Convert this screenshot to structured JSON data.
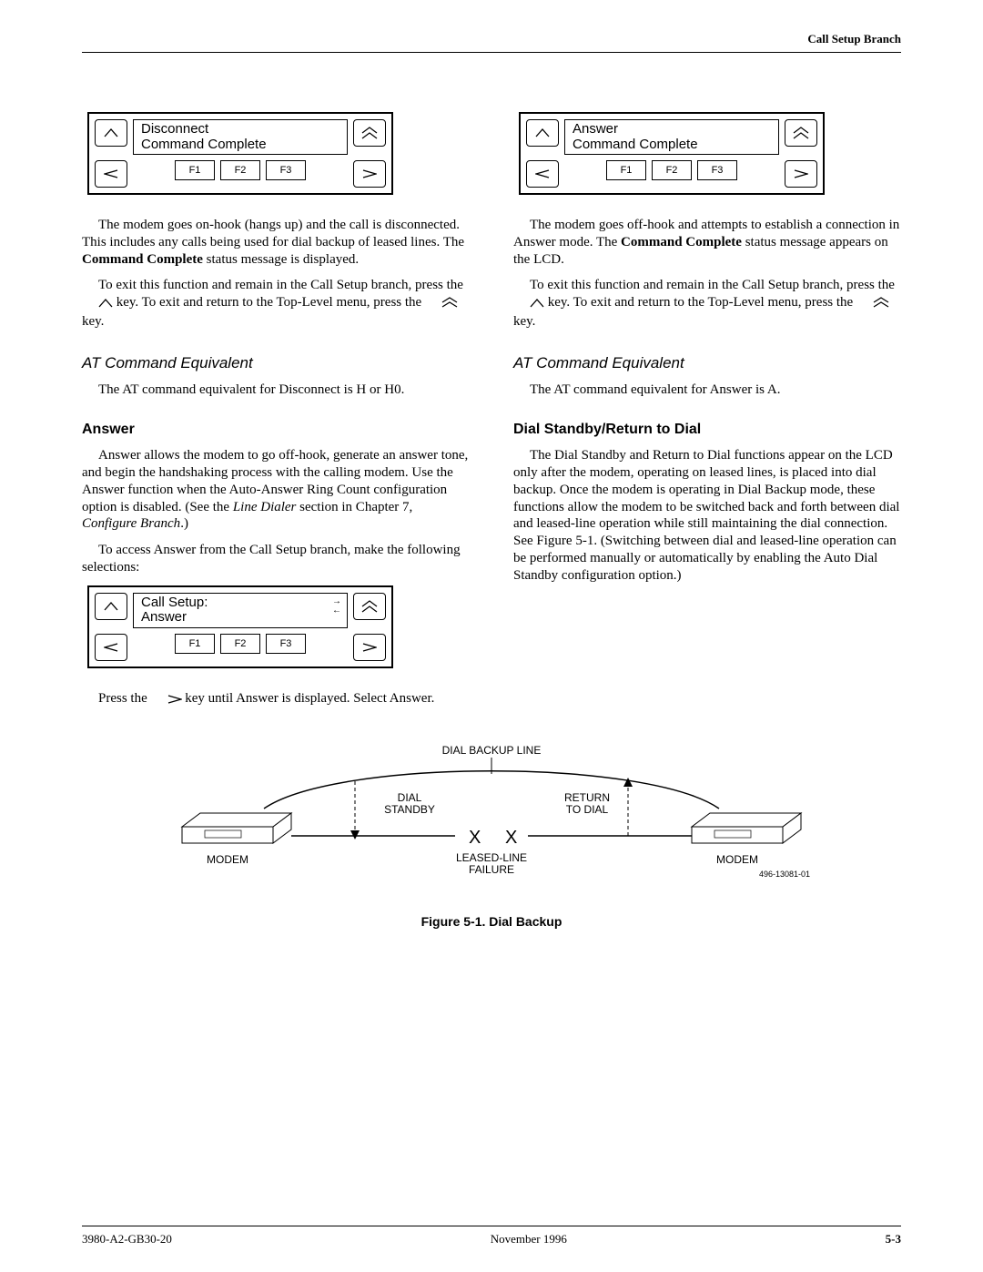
{
  "header": {
    "section": "Call Setup Branch"
  },
  "lcd_disconnect": {
    "line1": "Disconnect",
    "line2": "Command Complete",
    "f1": "F1",
    "f2": "F2",
    "f3": "F3"
  },
  "lcd_callsetup": {
    "line1": "Call Setup:",
    "line2": "Answer",
    "f1": "F1",
    "f2": "F2",
    "f3": "F3"
  },
  "lcd_answer": {
    "line1": "Answer",
    "line2": "Command Complete",
    "f1": "F1",
    "f2": "F2",
    "f3": "F3"
  },
  "left": {
    "para1a": "The modem goes on-hook (hangs up) and the call is disconnected. This includes any calls being used for dial backup of leased lines. The ",
    "para1b": "Command Complete",
    "para1c": " status message is displayed.",
    "para2a": "To exit this function and remain in the Call Setup branch, press the ",
    "para2b": " key. To exit and return to the Top-Level menu, press the ",
    "para2c": " key.",
    "at_heading": "AT Command Equivalent",
    "at_para": "The AT command equivalent for Disconnect is H or H0.",
    "answer_heading": "Answer",
    "answer_para1a": "Answer allows the modem to go off-hook, generate an answer tone, and begin the handshaking process with the calling modem. Use the Answer function when the Auto-Answer Ring Count configuration option is disabled. (See the ",
    "answer_para1b": "Line Dialer",
    "answer_para1c": " section in Chapter 7, ",
    "answer_para1d": "Configure Branch",
    "answer_para1e": ".)",
    "answer_para2": "To access Answer from the Call Setup branch, make the following selections:",
    "press_a": "Press the ",
    "press_b": " key until Answer is displayed. Select Answer."
  },
  "right": {
    "para1a": "The modem goes off-hook and attempts to establish a connection in Answer mode. The ",
    "para1b": "Command Complete",
    "para1c": " status message appears on the LCD.",
    "para2a": "To exit this function and remain in the Call Setup branch, press the ",
    "para2b": " key. To exit and return to the Top-Level menu, press the ",
    "para2c": " key.",
    "at_heading": "AT Command Equivalent",
    "at_para": "The AT command equivalent for Answer is A.",
    "dial_heading": "Dial Standby/Return to Dial",
    "dial_para": "The Dial Standby and Return to Dial functions appear on the LCD only after the modem, operating on leased lines, is placed into dial backup. Once the modem is operating in Dial Backup mode, these functions allow the modem to be switched back and forth between dial and leased-line operation while still maintaining the dial connection. See Figure 5-1. (Switching between dial and leased-line operation can be performed manually or automatically by enabling the Auto Dial Standby configuration option.)"
  },
  "figure": {
    "labels": {
      "dial_backup_line": "DIAL BACKUP LINE",
      "dial_standby": "DIAL\nSTANDBY",
      "return_to_dial": "RETURN\nTO DIAL",
      "modem": "MODEM",
      "leased_line_failure": "LEASED-LINE\nFAILURE",
      "drawing_no": "496-13081-01"
    },
    "caption": "Figure 5-1.  Dial Backup"
  },
  "footer": {
    "left": "3980-A2-GB30-20",
    "center": "November 1996",
    "right": "5-3"
  }
}
